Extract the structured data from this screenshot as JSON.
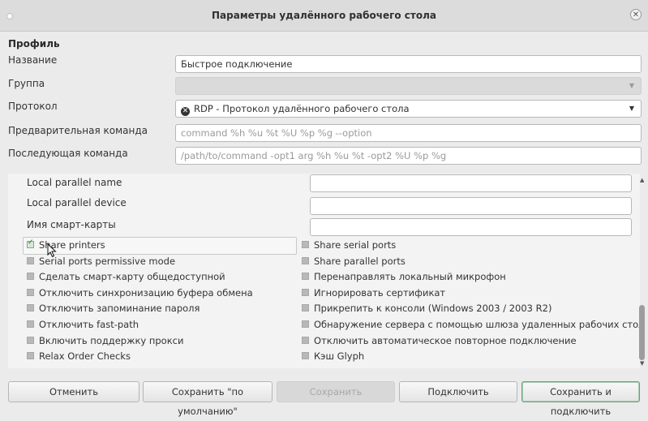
{
  "window": {
    "title": "Параметры удалённого рабочего стола"
  },
  "profile": {
    "heading": "Профиль",
    "name_label": "Название",
    "name_value": "Быстрое подключение",
    "group_label": "Группа",
    "group_value": "",
    "protocol_label": "Протокол",
    "protocol_value": "RDP - Протокол удалённого рабочего стола",
    "pre_cmd_label": "Предварительная команда",
    "pre_cmd_placeholder": "command %h %u %t %U %p %g --option",
    "post_cmd_label": "Последующая команда",
    "post_cmd_placeholder": "/path/to/command -opt1 arg %h %u %t -opt2 %U %p %g"
  },
  "panel": {
    "parallel_name_label": "Local parallel name",
    "parallel_device_label": "Local parallel device",
    "smartcard_label": "Имя смарт-карты",
    "checkboxes_left": [
      {
        "label": "Share printers",
        "checked": true
      },
      {
        "label": "Serial ports permissive mode",
        "checked": false
      },
      {
        "label": "Сделать смарт-карту общедоступной",
        "checked": false
      },
      {
        "label": "Отключить синхронизацию буфера обмена",
        "checked": false
      },
      {
        "label": "Отключить запоминание пароля",
        "checked": false
      },
      {
        "label": "Отключить fast-path",
        "checked": false
      },
      {
        "label": "Включить поддержку прокси",
        "checked": false
      },
      {
        "label": "Relax Order Checks",
        "checked": false
      }
    ],
    "checkboxes_right": [
      {
        "label": "Share serial ports",
        "checked": false
      },
      {
        "label": "Share parallel ports",
        "checked": false
      },
      {
        "label": "Перенаправлять локальный микрофон",
        "checked": false
      },
      {
        "label": "Игнорировать сертификат",
        "checked": false
      },
      {
        "label": "Прикрепить к консоли (Windows 2003 / 2003 R2)",
        "checked": false
      },
      {
        "label": "Обнаружение сервера с помощью шлюза удаленных рабочих столов",
        "checked": false
      },
      {
        "label": "Отключить автоматическое повторное подключение",
        "checked": false
      },
      {
        "label": "Кэш Glyph",
        "checked": false
      }
    ]
  },
  "buttons": {
    "cancel": "Отменить",
    "save_default": "Сохранить \"по умолчанию\"",
    "save": "Сохранить",
    "connect": "Подключить",
    "save_connect": "Сохранить и подключить"
  }
}
